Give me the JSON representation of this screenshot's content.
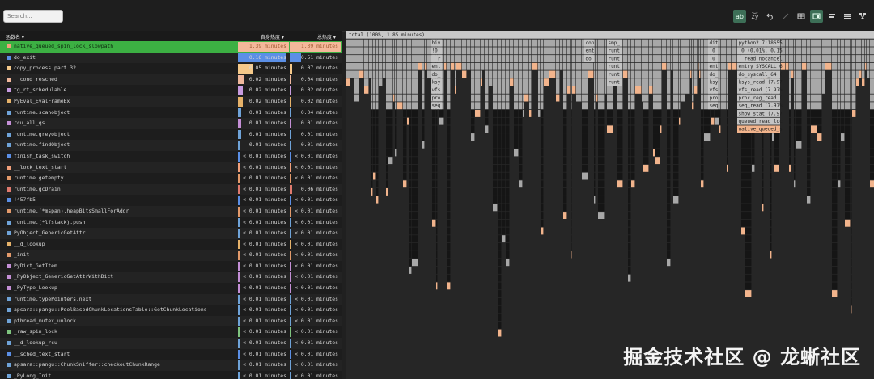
{
  "search": {
    "placeholder": "Search..."
  },
  "toolbar": {
    "items": [
      {
        "icon": "ab-icon",
        "label": "ab",
        "active": true
      },
      {
        "icon": "zy-icon",
        "label": "z͝y",
        "active": false
      },
      {
        "icon": "undo-icon",
        "label": "",
        "active": false
      },
      {
        "icon": "edit-icon",
        "label": "",
        "active": false
      },
      {
        "icon": "table-view-icon",
        "label": "",
        "active": false
      },
      {
        "icon": "table-flame-view-icon",
        "label": "",
        "active": true
      },
      {
        "icon": "flame-view-icon",
        "label": "",
        "active": false
      },
      {
        "icon": "sandwich-view-icon",
        "label": "",
        "active": false
      },
      {
        "icon": "graph-view-icon",
        "label": "",
        "active": false
      }
    ]
  },
  "table": {
    "headers": {
      "name": "函数名 ▾",
      "self": "自身热度 ▾",
      "total": "总热度 ▾"
    },
    "rows": [
      {
        "name": "native_queued_spin_lock_slowpath",
        "self": "1.39 minutes",
        "total": "1.39 minutes",
        "color": "#f2a07b",
        "self_frac": 1.0,
        "total_frac": 1.0
      },
      {
        "name": "do_exit",
        "self": "0.16 minutes",
        "total": "0.51 minutes",
        "color": "#5b8fe6",
        "self_frac": 0.96,
        "total_frac": 0.23
      },
      {
        "name": "copy_process.part.32",
        "self": "0.05 minutes",
        "total": "0.07 minutes",
        "color": "#f5c98a",
        "self_frac": 0.3,
        "total_frac": 0.05
      },
      {
        "name": "__cond_resched",
        "self": "0.02 minutes",
        "total": "0.04 minutes",
        "color": "#f0b89c",
        "self_frac": 0.12,
        "total_frac": 0.03
      },
      {
        "name": "tg_rt_schedulable",
        "self": "0.02 minutes",
        "total": "0.02 minutes",
        "color": "#c79be0",
        "self_frac": 0.1,
        "total_frac": 0.015
      },
      {
        "name": "PyEval_EvalFrameEx",
        "self": "0.02 minutes",
        "total": "0.02 minutes",
        "color": "#e6b26a",
        "self_frac": 0.1,
        "total_frac": 0.015
      },
      {
        "name": "runtime.scanobject",
        "self": "0.01 minutes",
        "total": "0.04 minutes",
        "color": "#6fa3d8",
        "self_frac": 0.07,
        "total_frac": 0.03
      },
      {
        "name": "rcu_all_qs",
        "self": "0.01 minutes",
        "total": "0.01 minutes",
        "color": "#c48fd6",
        "self_frac": 0.06,
        "total_frac": 0.01
      },
      {
        "name": "runtime.greyobject",
        "self": "0.01 minutes",
        "total": "0.01 minutes",
        "color": "#6fa3d8",
        "self_frac": 0.06,
        "total_frac": 0.01
      },
      {
        "name": "runtime.findObject",
        "self": "0.01 minutes",
        "total": "0.01 minutes",
        "color": "#6fa3d8",
        "self_frac": 0.05,
        "total_frac": 0.01
      },
      {
        "name": "finish_task_switch",
        "self": "< 0.01 minutes",
        "total": "< 0.01 minutes",
        "color": "#5b8fe6",
        "self_frac": 0.04,
        "total_frac": 0.005
      },
      {
        "name": "__lock_text_start",
        "self": "< 0.01 minutes",
        "total": "< 0.01 minutes",
        "color": "#f2a07b",
        "self_frac": 0.04,
        "total_frac": 0.005
      },
      {
        "name": "runtime.getempty",
        "self": "< 0.01 minutes",
        "total": "< 0.01 minutes",
        "color": "#e39a6b",
        "self_frac": 0.03,
        "total_frac": 0.005
      },
      {
        "name": "runtime.gcDrain",
        "self": "< 0.01 minutes",
        "total": "0.06 minutes",
        "color": "#e07a6e",
        "self_frac": 0.03,
        "total_frac": 0.04
      },
      {
        "name": "!457fb5",
        "self": "< 0.01 minutes",
        "total": "< 0.01 minutes",
        "color": "#5b8fe6",
        "self_frac": 0.03,
        "total_frac": 0.005
      },
      {
        "name": "runtime.(*mspan).heapBitsSmallForAddr",
        "self": "< 0.01 minutes",
        "total": "< 0.01 minutes",
        "color": "#e39a6b",
        "self_frac": 0.03,
        "total_frac": 0.005
      },
      {
        "name": "runtime.(*lfstack).push",
        "self": "< 0.01 minutes",
        "total": "< 0.01 minutes",
        "color": "#6fa3d8",
        "self_frac": 0.02,
        "total_frac": 0.005
      },
      {
        "name": "PyObject_GenericGetAttr",
        "self": "< 0.01 minutes",
        "total": "< 0.01 minutes",
        "color": "#6fa3d8",
        "self_frac": 0.02,
        "total_frac": 0.005
      },
      {
        "name": "__d_lookup",
        "self": "< 0.01 minutes",
        "total": "< 0.01 minutes",
        "color": "#e6b26a",
        "self_frac": 0.02,
        "total_frac": 0.005
      },
      {
        "name": "_init",
        "self": "< 0.01 minutes",
        "total": "< 0.01 minutes",
        "color": "#e39a6b",
        "self_frac": 0.02,
        "total_frac": 0.005
      },
      {
        "name": "PyDict_GetItem",
        "self": "< 0.01 minutes",
        "total": "< 0.01 minutes",
        "color": "#c48fd6",
        "self_frac": 0.02,
        "total_frac": 0.005
      },
      {
        "name": "_PyObject_GenericGetAttrWithDict",
        "self": "< 0.01 minutes",
        "total": "< 0.01 minutes",
        "color": "#c48fd6",
        "self_frac": 0.02,
        "total_frac": 0.005
      },
      {
        "name": "_PyType_Lookup",
        "self": "< 0.01 minutes",
        "total": "< 0.01 minutes",
        "color": "#c48fd6",
        "self_frac": 0.02,
        "total_frac": 0.005
      },
      {
        "name": "runtime.typePointers.next",
        "self": "< 0.01 minutes",
        "total": "< 0.01 minutes",
        "color": "#6fa3d8",
        "self_frac": 0.02,
        "total_frac": 0.005
      },
      {
        "name": "apsara::pangu::PoolBasedChunkLocationsTable::GetChunkLocations",
        "self": "< 0.01 minutes",
        "total": "< 0.01 minutes",
        "color": "#6fa3d8",
        "self_frac": 0.02,
        "total_frac": 0.005
      },
      {
        "name": "pthread_mutex_unlock",
        "self": "< 0.01 minutes",
        "total": "< 0.01 minutes",
        "color": "#6fa3d8",
        "self_frac": 0.02,
        "total_frac": 0.005
      },
      {
        "name": "_raw_spin_lock",
        "self": "< 0.01 minutes",
        "total": "< 0.01 minutes",
        "color": "#7fc47f",
        "self_frac": 0.02,
        "total_frac": 0.005
      },
      {
        "name": "__d_lookup_rcu",
        "self": "< 0.01 minutes",
        "total": "< 0.01 minutes",
        "color": "#6fa3d8",
        "self_frac": 0.02,
        "total_frac": 0.005
      },
      {
        "name": "__sched_text_start",
        "self": "< 0.01 minutes",
        "total": "< 0.01 minutes",
        "color": "#5b8fe6",
        "self_frac": 0.02,
        "total_frac": 0.005
      },
      {
        "name": "apsara::pangu::ChunkSniffer::checkoutChunkRange",
        "self": "< 0.01 minutes",
        "total": "< 0.01 minutes",
        "color": "#6fa3d8",
        "self_frac": 0.02,
        "total_frac": 0.005
      },
      {
        "name": "_PyLong_Init",
        "self": "< 0.01 minutes",
        "total": "< 0.01 minutes",
        "color": "#6fa3d8",
        "self_frac": 0.02,
        "total_frac": 0.005
      }
    ]
  },
  "flame": {
    "root_label": "total (100%, 1.85 minutes)",
    "labels": [
      {
        "column": "a",
        "lines": [
          "hiv",
          "!0",
          "__r",
          "ent",
          "do_",
          "ksy",
          "vfs",
          "pro",
          "seq"
        ]
      },
      {
        "column": "b",
        "lines": [
          "con",
          "ent",
          "do_"
        ]
      },
      {
        "column": "c",
        "lines": [
          "smp_",
          "runt",
          "runt",
          "runt",
          "runt",
          "runt"
        ]
      },
      {
        "column": "d",
        "lines": [
          "dit",
          "!0",
          "!0",
          "ent",
          "do_",
          "ksy",
          "vfs",
          "pro",
          "seq"
        ]
      },
      {
        "column": "e",
        "lines": [
          "python2.7:18655",
          "!0 (0.01%, 0.15",
          "__read_nocancel",
          "entry_SYSCALL_6",
          "do_syscall_64 (",
          "ksys_read (7.97",
          "vfs_read (7.97%",
          "proc_reg_read (",
          "seq_read (7.97%",
          "show_stat (7.97",
          "queued_read_loc",
          "native_queued_s"
        ]
      }
    ]
  },
  "watermark": "掘金技术社区 @ 龙蜥社区"
}
